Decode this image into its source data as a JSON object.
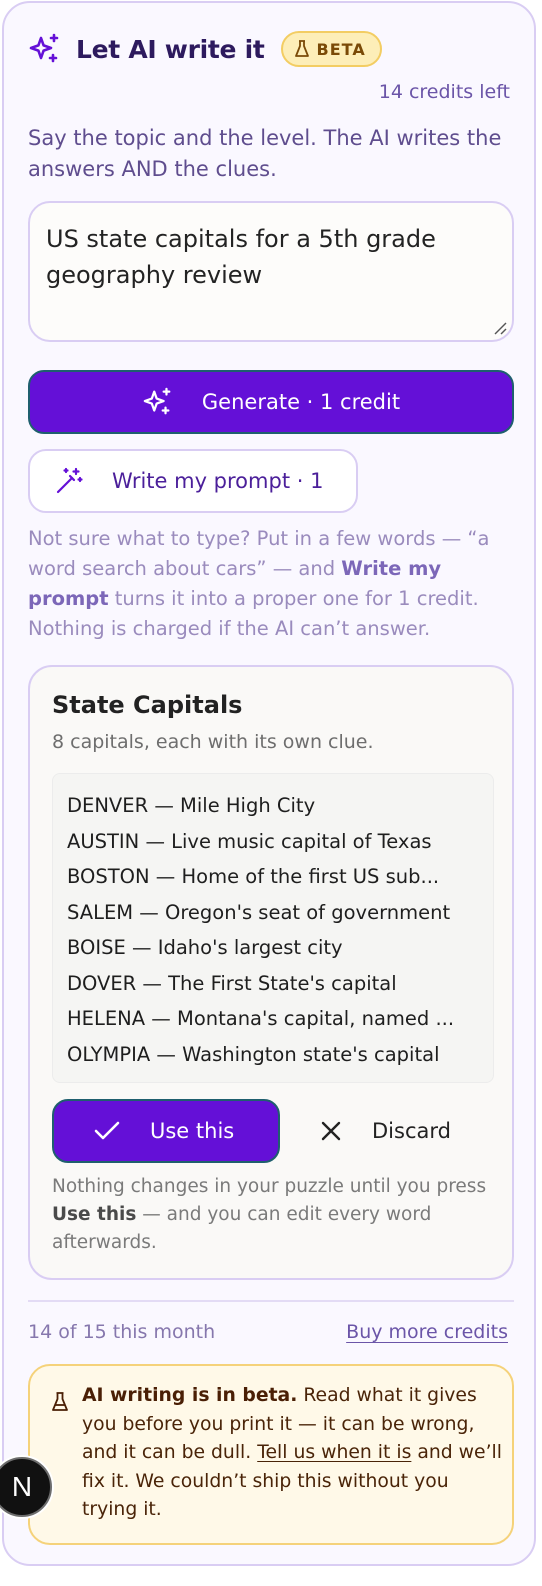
{
  "header": {
    "title": "Let AI write it",
    "badge": "BETA",
    "credits_left": "14 credits left"
  },
  "intro": "Say the topic and the level. The AI writes the answers AND the clues.",
  "prompt": {
    "value": "US state capitals for a 5th grade geography review"
  },
  "buttons": {
    "generate": "Generate · 1 credit",
    "write_prompt": "Write my prompt · 1"
  },
  "hint": {
    "part1": "Not sure what to type? Put in a few words — “a word search about cars” — and ",
    "bold": "Write my prompt",
    "part2": " turns it into a proper one for 1 credit. Nothing is charged if the AI can’t answer."
  },
  "result": {
    "title": "State Capitals",
    "subtitle": "8 capitals, each with its own clue.",
    "items": [
      "DENVER — Mile High City",
      "AUSTIN — Live music capital of Texas",
      "BOSTON — Home of the first US sub...",
      "SALEM — Oregon's seat of government",
      "BOISE — Idaho's largest city",
      "DOVER — The First State's capital",
      "HELENA — Montana's capital, named ...",
      "OLYMPIA — Washington state's capital"
    ],
    "use_label": "Use this",
    "discard_label": "Discard",
    "note_part1": "Nothing changes in your puzzle until you press ",
    "note_bold": "Use this",
    "note_part2": " — and you can edit every word afterwards."
  },
  "footer": {
    "month": "14 of 15 this month",
    "buy": "Buy more credits"
  },
  "beta_note": {
    "bold": "AI writing is in beta.",
    "part1": " Read what it gives you before you print it — it can be wrong, and it can be dull. ",
    "link": "Tell us when it is",
    "part2": " and we’ll fix it. We couldn’t ship this without you trying it."
  },
  "avatar": {
    "letter": "N"
  },
  "colors": {
    "accent": "#6410d7",
    "panel_border": "#d9cdf3",
    "beta_bg": "#fdeeb8",
    "note_bg": "#fff9e8"
  }
}
